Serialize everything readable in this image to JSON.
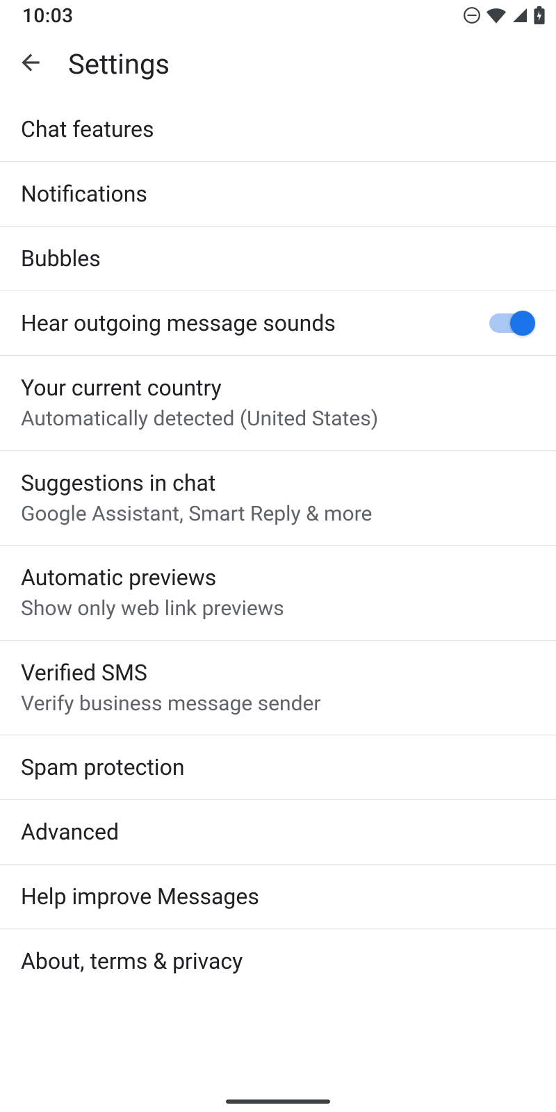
{
  "status": {
    "time": "10:03"
  },
  "header": {
    "title": "Settings"
  },
  "items": {
    "chat_features": {
      "title": "Chat features"
    },
    "notifications": {
      "title": "Notifications"
    },
    "bubbles": {
      "title": "Bubbles"
    },
    "hear_outgoing": {
      "title": "Hear outgoing message sounds",
      "enabled": true
    },
    "current_country": {
      "title": "Your current country",
      "sub": "Automatically detected (United States)"
    },
    "suggestions": {
      "title": "Suggestions in chat",
      "sub": "Google Assistant, Smart Reply & more"
    },
    "auto_previews": {
      "title": "Automatic previews",
      "sub": "Show only web link previews"
    },
    "verified_sms": {
      "title": "Verified SMS",
      "sub": "Verify business message sender"
    },
    "spam_protection": {
      "title": "Spam protection"
    },
    "advanced": {
      "title": "Advanced"
    },
    "help_improve": {
      "title": "Help improve Messages"
    },
    "about_terms": {
      "title": "About, terms & privacy"
    }
  }
}
